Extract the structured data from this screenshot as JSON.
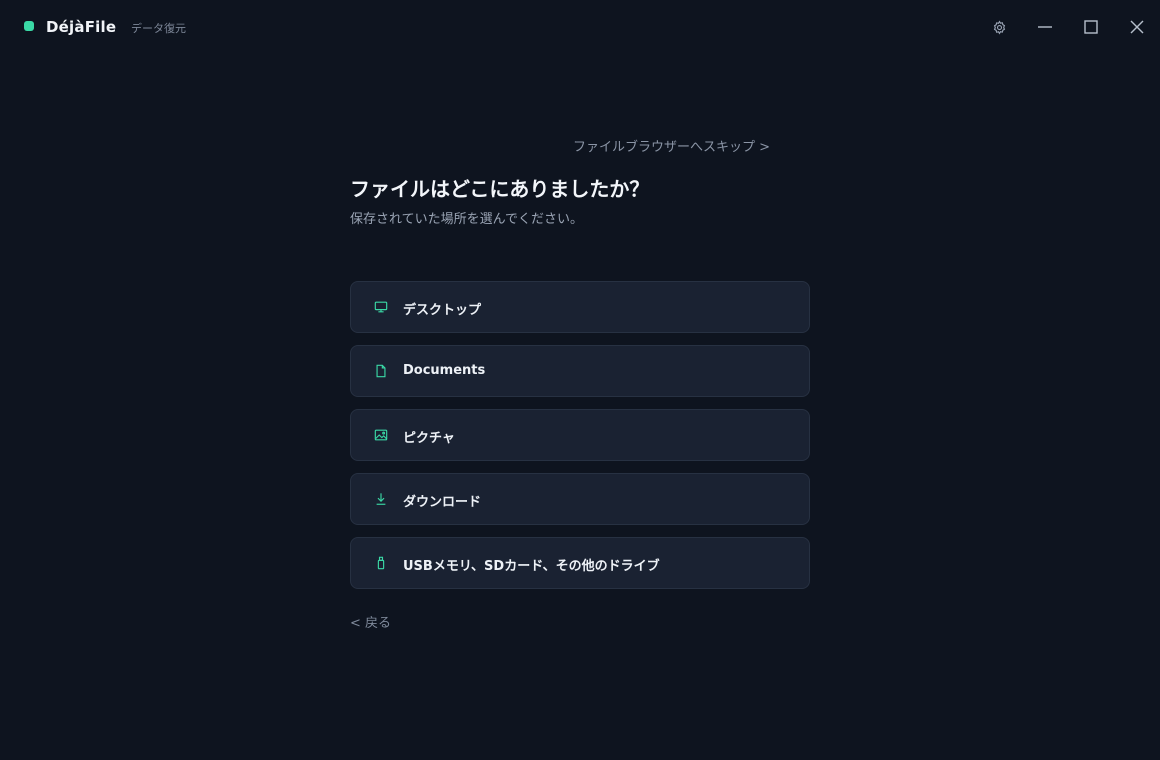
{
  "app": {
    "name": "DéjàFile",
    "subtitle": "データ復元"
  },
  "window_controls": [
    "gear-icon",
    "minimize-icon",
    "maximize-icon",
    "close-icon"
  ],
  "page": {
    "skip_link": "ファイルブラウザーへスキップ >",
    "title": "ファイルはどこにありましたか？",
    "subtitle": "保存されていた場所を選んでください。",
    "back_link": "< 戻る"
  },
  "options": [
    {
      "label": "デスクトップ",
      "icon": "monitor-icon"
    },
    {
      "label": "Documents",
      "icon": "document-icon"
    },
    {
      "label": "ピクチャ",
      "icon": "image-icon"
    },
    {
      "label": "ダウンロード",
      "icon": "download-icon"
    },
    {
      "label": "USBメモリ、SDカード、その他のドライブ",
      "icon": "usb-drive-icon"
    }
  ],
  "colors": {
    "background": "#0e141f",
    "card": "#1a2232",
    "card_border": "#273142",
    "accent": "#3ad9a6",
    "text_primary": "#eef2f7",
    "text_muted": "#8b95a6"
  }
}
